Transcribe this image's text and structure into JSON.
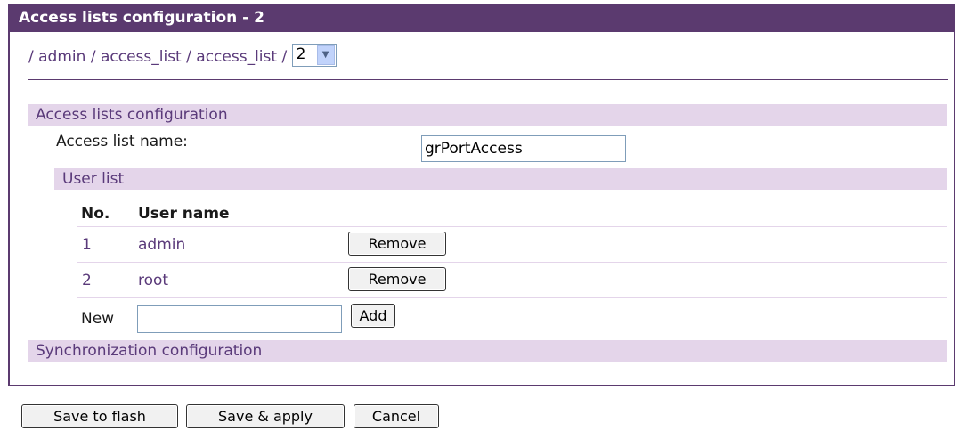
{
  "window": {
    "title": "Access lists configuration - 2"
  },
  "breadcrumb": {
    "prefix": "/ ",
    "items": [
      "admin",
      "access_list",
      "access_list"
    ],
    "separator": " / ",
    "selector_value": "2"
  },
  "access_section": {
    "title": "Access lists configuration",
    "name_label": "Access list name:",
    "name_value": "grPortAccess"
  },
  "user_list": {
    "title": "User list",
    "col_no": "No.",
    "col_user": "User name",
    "rows": [
      {
        "no": "1",
        "name": "admin",
        "remove_label": "Remove"
      },
      {
        "no": "2",
        "name": "root",
        "remove_label": "Remove"
      }
    ],
    "new_label": "New",
    "new_value": "",
    "add_label": "Add"
  },
  "sync_section": {
    "title": "Synchronization configuration"
  },
  "footer": {
    "save_flash_label": "Save to flash",
    "save_apply_label": "Save & apply",
    "cancel_label": "Cancel"
  },
  "colors": {
    "accent": "#5b3a6f",
    "section_bg": "#e4d5ea",
    "link": "#5a3a7a"
  }
}
